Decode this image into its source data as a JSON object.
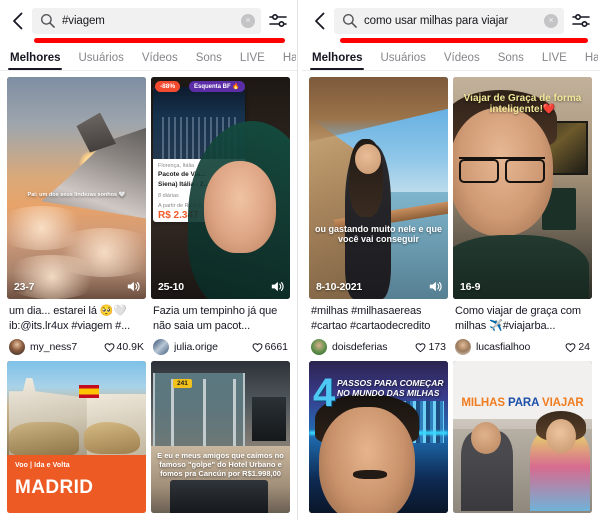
{
  "panels": [
    {
      "search": {
        "value": "#viagem",
        "clear_label": "×"
      },
      "tabs": [
        {
          "label": "Melhores",
          "active": true
        },
        {
          "label": "Usuários",
          "active": false
        },
        {
          "label": "Vídeos",
          "active": false
        },
        {
          "label": "Sons",
          "active": false
        },
        {
          "label": "LIVE",
          "active": false
        },
        {
          "label": "Ha",
          "active": false
        }
      ],
      "cards": [
        {
          "date": "23-7",
          "overlay": "Pai: um dos seus lindezas sonhos 🤍",
          "title": "um dia... estarei lá 🥺🤍 ib:@its.lr4ux #viagem #...",
          "user": "my_ness7",
          "likes": "40.9K"
        },
        {
          "date": "25-10",
          "badge_off": "-88%",
          "badge_bf": "Esquenta BF 🔥",
          "card_line1": "Florença, Itália",
          "card_line2": "Pacote de Via...",
          "card_line3": "Siena) Itália - 2...",
          "card_line4": "8 diárias",
          "card_line5": "A partir de  R$ 4.6...",
          "card_price": "R$ 2.347",
          "title": "Fazia um tempinho já que não saia um pacot...",
          "user": "julia.orige",
          "likes": "6661"
        },
        {
          "banner_top": "Voo | Ida e Volta",
          "banner_main": "MADRID"
        },
        {
          "tag": "241",
          "overlay": "E eu e meus amigos que caímos no famoso \"golpe\" do Hotel Urbano e fomos pra Cancún por R$1.998,00"
        }
      ]
    },
    {
      "search": {
        "value": "como usar milhas para viajar",
        "clear_label": "×"
      },
      "tabs": [
        {
          "label": "Melhores",
          "active": true
        },
        {
          "label": "Usuários",
          "active": false
        },
        {
          "label": "Vídeos",
          "active": false
        },
        {
          "label": "Sons",
          "active": false
        },
        {
          "label": "LIVE",
          "active": false
        },
        {
          "label": "Ha",
          "active": false
        }
      ],
      "cards": [
        {
          "date": "8-10-2021",
          "overlay": "ou gastando muito nele e que você vai conseguir",
          "title": "#milhas #milhasaereas #cartao #cartaodecredito",
          "user": "doisdeferias",
          "likes": "173"
        },
        {
          "date": "16-9",
          "overlay": "Viajar de Graça de forma inteligente!❤️",
          "title": "Como viajar de graça com milhas ✈️#viajarba...",
          "user": "lucasfialhoo",
          "likes": "24"
        },
        {
          "number": "4",
          "overlay": "PASSOS PARA COMEÇAR NO MUNDO DAS MILHAS"
        },
        {
          "title_o1": "MILHAS ",
          "title_b": "PARA ",
          "title_o2": "VIAJAR"
        }
      ]
    }
  ],
  "icons": {
    "back": "chevron-left-icon",
    "search": "search-icon",
    "clear": "clear-icon",
    "filter": "filter-icon",
    "sound": "sound-icon",
    "like": "heart-icon"
  },
  "colors": {
    "accent_red": "#ff0000",
    "text_primary": "#161722",
    "text_muted": "#86868b",
    "field_bg": "#f1f1f2",
    "orange": "#ee5a24",
    "blue": "#1b4fa8"
  }
}
